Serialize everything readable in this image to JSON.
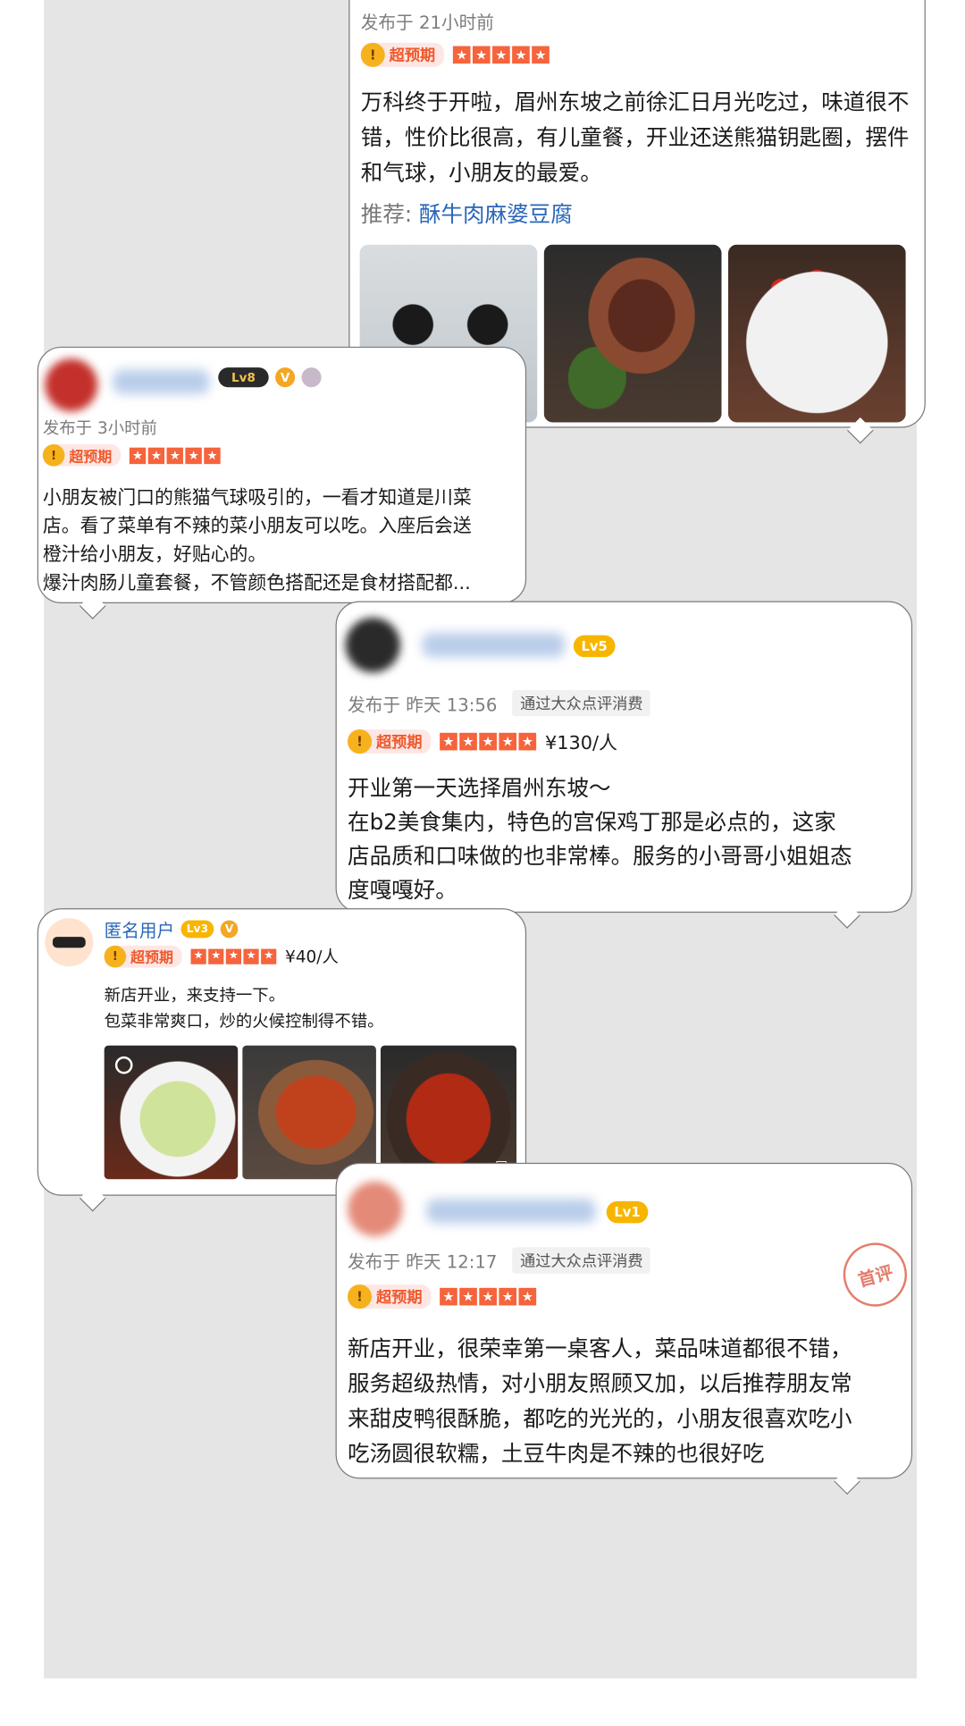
{
  "reviews": [
    {
      "time_prefix": "发布于",
      "time": "21小时前",
      "tag": "超预期",
      "text": "万科终于开啦，眉州东坡之前徐汇日月光吃过，味道很不错，性价比很高，有儿童餐，开业还送熊猫钥匙圈，摆件和气球，小朋友的最爱。",
      "recommend_label": "推荐:",
      "recommend_dish": "酥牛肉麻婆豆腐"
    },
    {
      "level": "Lv8",
      "time_prefix": "发布于",
      "time": "3小时前",
      "tag": "超预期",
      "text_lines": [
        "小朋友被门口的熊猫气球吸引的，一看才知道是川菜",
        "店。看了菜单有不辣的菜小朋友可以吃。入座后会送",
        "橙汁给小朋友，好贴心的。",
        "爆汁肉肠儿童套餐，不管颜色搭配还是食材搭配都..."
      ]
    },
    {
      "level": "Lv5",
      "time_prefix": "发布于",
      "time": "昨天 13:56",
      "verified": "通过大众点评消费",
      "tag": "超预期",
      "price": "¥130/人",
      "text_lines": [
        "开业第一天选择眉州东坡～",
        "在b2美食集内，特色的宫保鸡丁那是必点的，这家",
        "店品质和口味做的也非常棒。服务的小哥哥小姐姐态",
        "度嘎嘎好。"
      ]
    },
    {
      "user": "匿名用户",
      "level": "Lv3",
      "tag": "超预期",
      "price": "¥40/人",
      "text_lines": [
        "新店开业，来支持一下。",
        "包菜非常爽口，炒的火候控制得不错。"
      ]
    },
    {
      "level": "Lv1",
      "time_prefix": "发布于",
      "time": "昨天 12:17",
      "verified": "通过大众点评消费",
      "tag": "超预期",
      "stamp_text": "首评",
      "text_lines": [
        "新店开业，很荣幸第一桌客人，菜品味道都很不错，",
        "服务超级热情，对小朋友照顾又加，以后推荐朋友常",
        "来甜皮鸭很酥脆，都吃的光光的，小朋友很喜欢吃小",
        "吃汤圆很软糯，土豆牛肉是不辣的也很好吃"
      ]
    }
  ],
  "colors": {
    "accent": "#f5643c",
    "tag_bg": "#fde7e4",
    "link": "#2a66b8",
    "level": "#f7b500"
  }
}
